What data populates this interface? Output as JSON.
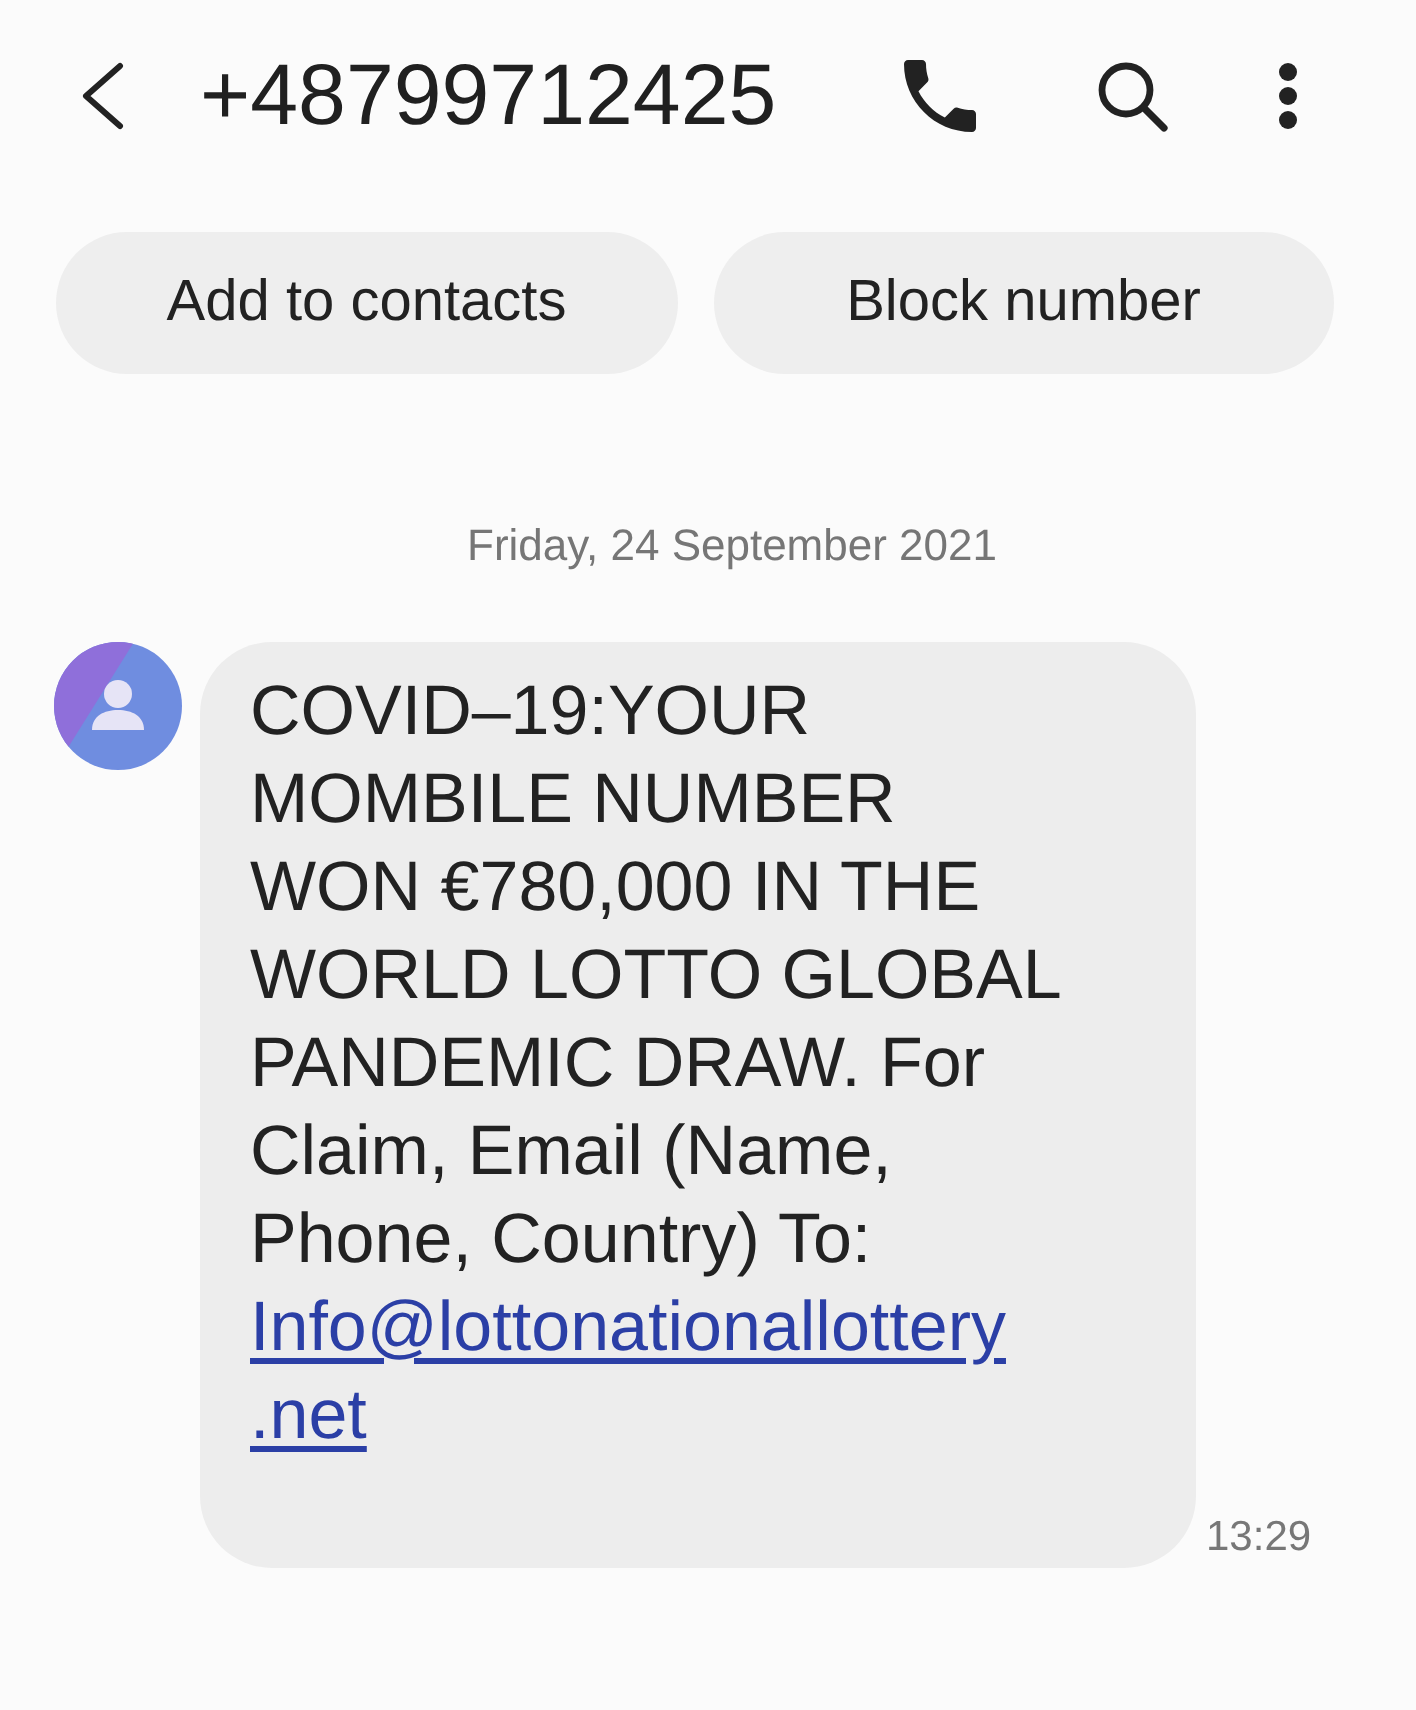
{
  "header": {
    "title": "+48799712425"
  },
  "actions": [
    "Add to contacts",
    "Block number"
  ],
  "date_divider": "Friday, 24 September 2021",
  "messages": [
    {
      "text": "COVID–19:YOUR MOMBILE NUMBER WON €780,000 IN THE WORLD LOTTO GLOBAL PANDEMIC DRAW. For Claim, Email (Name, Phone, Country) To:",
      "link": "Info@lottonationallottery.net",
      "time": "13:29"
    }
  ]
}
